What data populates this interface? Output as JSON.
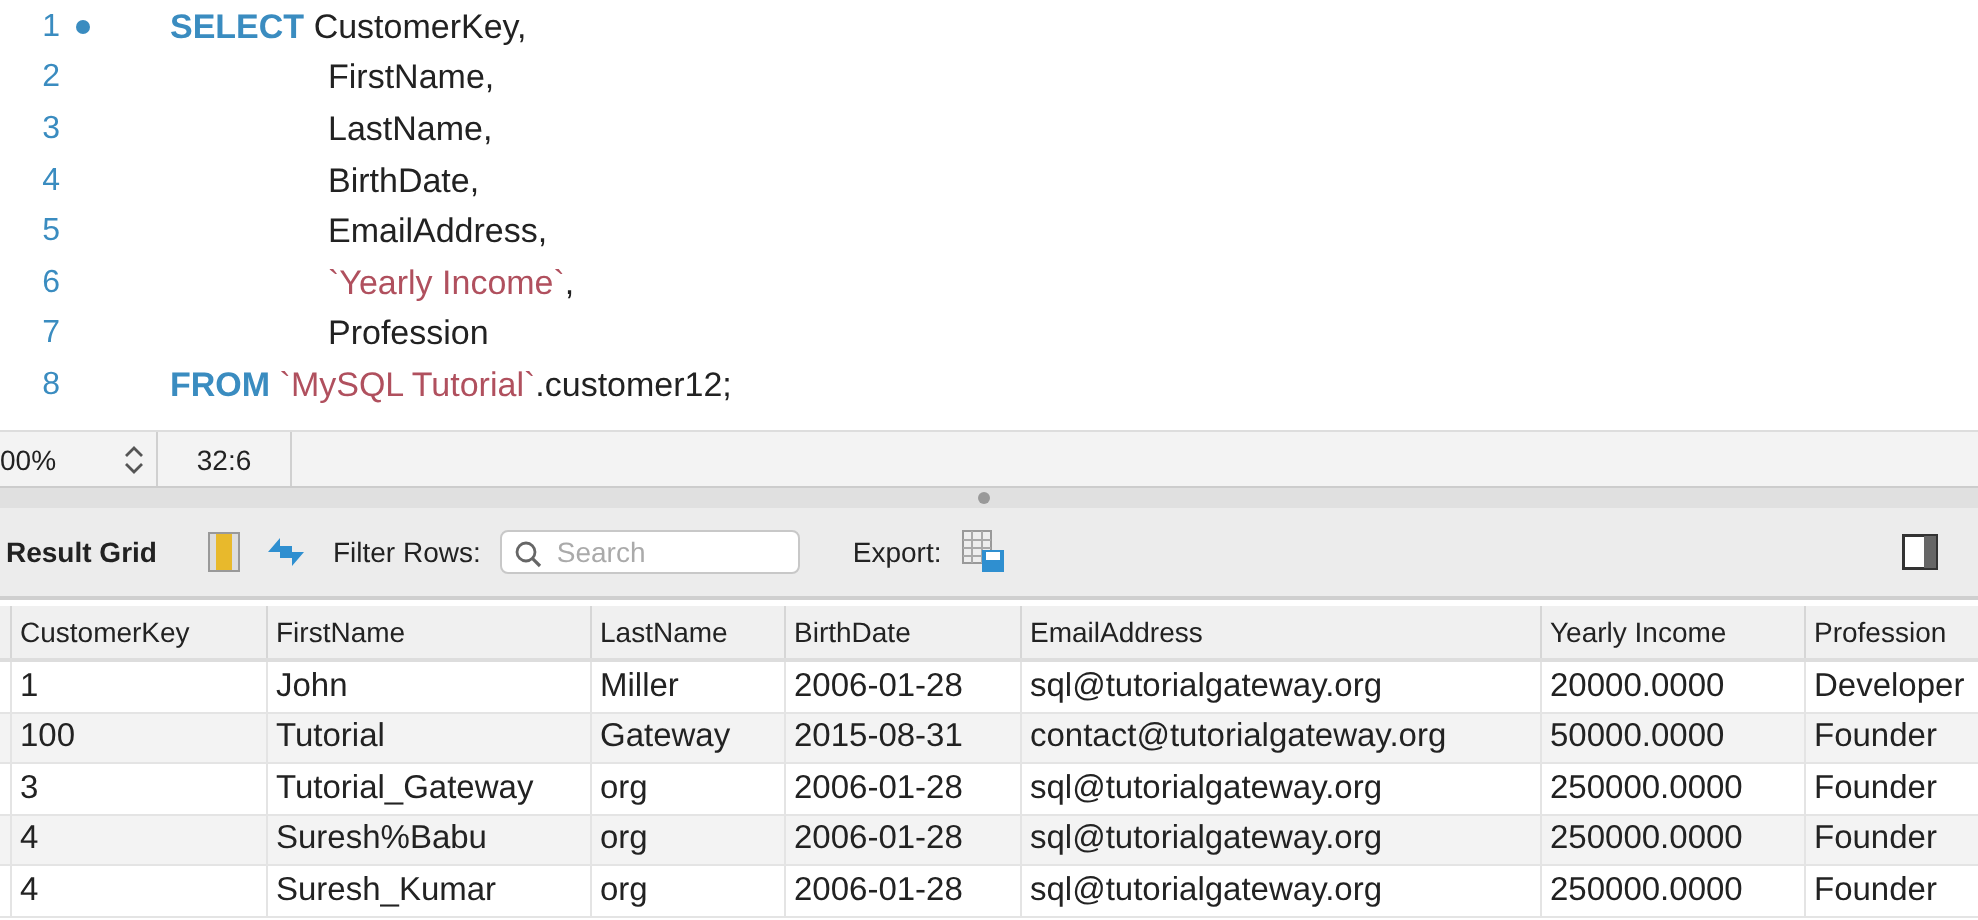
{
  "editor": {
    "lines": [
      {
        "number": "1",
        "marker": true,
        "indent": false,
        "tokens": [
          {
            "kind": "keyword",
            "text": "SELECT"
          },
          {
            "kind": "plain",
            "text": "CustomerKey,"
          }
        ]
      },
      {
        "number": "2",
        "marker": false,
        "indent": true,
        "tokens": [
          {
            "kind": "plain",
            "text": "FirstName,"
          }
        ]
      },
      {
        "number": "3",
        "marker": false,
        "indent": true,
        "tokens": [
          {
            "kind": "plain",
            "text": "LastName,"
          }
        ]
      },
      {
        "number": "4",
        "marker": false,
        "indent": true,
        "tokens": [
          {
            "kind": "plain",
            "text": "BirthDate,"
          }
        ]
      },
      {
        "number": "5",
        "marker": false,
        "indent": true,
        "tokens": [
          {
            "kind": "plain",
            "text": "EmailAddress,"
          }
        ]
      },
      {
        "number": "6",
        "marker": false,
        "indent": true,
        "tokens": [
          {
            "kind": "quoted",
            "text": "`Yearly Income`"
          },
          {
            "kind": "plain",
            "text": ","
          }
        ]
      },
      {
        "number": "7",
        "marker": false,
        "indent": true,
        "tokens": [
          {
            "kind": "plain",
            "text": "Profession"
          }
        ]
      },
      {
        "number": "8",
        "marker": false,
        "indent": false,
        "tokens": [
          {
            "kind": "keyword",
            "text": "FROM"
          },
          {
            "kind": "quoted",
            "text": "`MySQL Tutorial`"
          },
          {
            "kind": "plain",
            "text": ".customer12;"
          }
        ]
      }
    ]
  },
  "status_bar": {
    "zoom": "00%",
    "cursor": "32:6"
  },
  "result_toolbar": {
    "title": "Result Grid",
    "filter_label": "Filter Rows:",
    "search": {
      "placeholder": "Search"
    },
    "export_label": "Export:"
  },
  "table": {
    "columns": [
      "CustomerKey",
      "FirstName",
      "LastName",
      "BirthDate",
      "EmailAddress",
      "Yearly Income",
      "Profession"
    ],
    "rows": [
      [
        "1",
        "John",
        "Miller",
        "2006-01-28",
        "sql@tutorialgateway.org",
        "20000.0000",
        "Developer"
      ],
      [
        "100",
        "Tutorial",
        "Gateway",
        "2015-08-31",
        "contact@tutorialgateway.org",
        "50000.0000",
        "Founder"
      ],
      [
        "3",
        "Tutorial_Gateway",
        "org",
        "2006-01-28",
        "sql@tutorialgateway.org",
        "250000.0000",
        "Founder"
      ],
      [
        "4",
        "Suresh%Babu",
        "org",
        "2006-01-28",
        "sql@tutorialgateway.org",
        "250000.0000",
        "Founder"
      ],
      [
        "4",
        "Suresh_Kumar",
        "org",
        "2006-01-28",
        "sql@tutorialgateway.org",
        "250000.0000",
        "Founder"
      ]
    ]
  }
}
